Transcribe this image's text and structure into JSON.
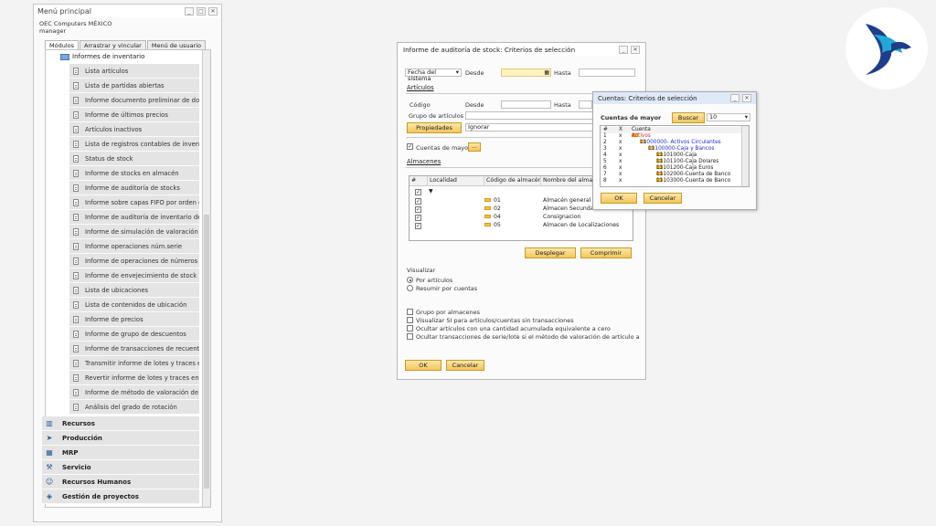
{
  "main_menu": {
    "title": "Menú principal",
    "company": "OEC Computers MÉXICO",
    "user": "manager",
    "tabs": [
      "Módulos",
      "Arrastrar y vincular",
      "Menú de usuario"
    ],
    "folder": "Informes de inventario",
    "reports": [
      "Lista artículos",
      "Lista de partidas abiertas",
      "Informe documento preliminar de docume",
      "Informe de últimos precios",
      "Artículos inactivos",
      "Lista de registros contables de inventario",
      "Status de stock",
      "Informe de stocks en almacén",
      "Informe de auditoría de stocks",
      "Informe sobre capas FIFO por orden de c",
      "Informe de auditoría de inventario de lote",
      "Informe de simulación de valoración de st",
      "Informe operaciones núm.serie",
      "Informe de operaciones de números de lo",
      "Informe de envejecimiento de stock",
      "Lista de ubicaciones",
      "Lista de contenidos de ubicación",
      "Informe de precios",
      "Informe de grupo de descuentos",
      "Informe de transacciones de recuento de",
      "Transmitir informe de lotes y traces en se",
      "Revertir informe de lotes y traces en serie",
      "Informe de método de valoración de stock",
      "Análisis del grado de rotación"
    ],
    "modules": [
      "Recursos",
      "Producción",
      "MRP",
      "Servicio",
      "Recursos Humanos",
      "Gestión de proyectos"
    ]
  },
  "stock_dialog": {
    "title": "Informe de auditoría de stock: Criterios de selección",
    "date_select": "Fecha del sistema",
    "from_label": "Desde",
    "to_label": "Hasta",
    "articles_section": "Artículos",
    "code_label": "Código",
    "code_from_label": "Desde",
    "code_to_label": "Hasta",
    "group_label": "Grupo de artículos",
    "properties_button": "Propiedades",
    "ignore_value": "Ignorar",
    "accounts_check_label": "Cuentas de mayor",
    "ellipsis_button": "...",
    "warehouses_section": "Almacenes",
    "grid_headers": [
      "#",
      "Localidad",
      "Código de almacén",
      "Nombre del almacén"
    ],
    "warehouses": [
      {
        "code": "01",
        "name": "Almacén general"
      },
      {
        "code": "02",
        "name": "Almacen Secundario"
      },
      {
        "code": "04",
        "name": "Consignacion"
      },
      {
        "code": "05",
        "name": "Almacen de Localizaciones"
      }
    ],
    "unfold_button": "Desplegar",
    "collapse_button": "Comprimir",
    "view_section": "Visualizar",
    "view_options": [
      "Por artículos",
      "Resumir por cuentas"
    ],
    "options": [
      "Grupo por almacenes",
      "Visualizar SI para artículos/cuentas sin transacciones",
      "Ocultar artículos con una cantidad acumulada equivalente a cero",
      "Ocultar transacciones de serie/lote si el método de valoración de artículo actual no es"
    ],
    "ok_button": "OK",
    "cancel_button": "Cancelar"
  },
  "accounts_popup": {
    "title": "Cuentas: Criterios de selección",
    "label": "Cuentas de mayor",
    "search_button": "Buscar",
    "search_value": "10",
    "headers": [
      "#",
      "X",
      "Cuenta"
    ],
    "rows": [
      {
        "n": "1",
        "x": "x",
        "account": "Activos",
        "level": 0,
        "color": "#d0302a"
      },
      {
        "n": "2",
        "x": "x",
        "account": "11000000- Activos Circulantes",
        "level": 1,
        "color": "#2230c8"
      },
      {
        "n": "3",
        "x": "x",
        "account": "11100000-Caja y Bancos",
        "level": 2,
        "color": "#2230c8"
      },
      {
        "n": "4",
        "x": "x",
        "account": "11101000-Caja",
        "level": 3,
        "color": "#222222"
      },
      {
        "n": "5",
        "x": "x",
        "account": "11101100-Caja Dolares",
        "level": 3,
        "color": "#222222"
      },
      {
        "n": "6",
        "x": "x",
        "account": "11101200-Caja Euros",
        "level": 3,
        "color": "#222222"
      },
      {
        "n": "7",
        "x": "x",
        "account": "11102000-Cuenta de Banco",
        "level": 3,
        "color": "#222222"
      },
      {
        "n": "8",
        "x": "x",
        "account": "11103000-Cuenta de Banco",
        "level": 3,
        "color": "#222222"
      }
    ],
    "ok_button": "OK",
    "cancel_button": "Cancelar"
  }
}
